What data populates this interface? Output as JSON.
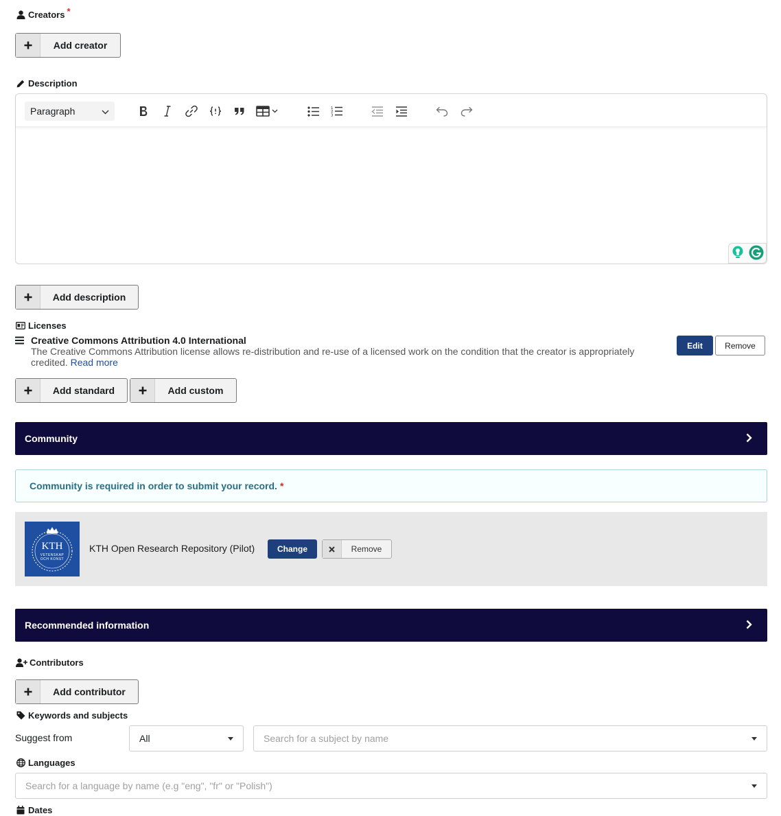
{
  "creators": {
    "label": "Creators",
    "required_mark": "*",
    "add_button": "Add creator"
  },
  "description": {
    "label": "Description",
    "toolbar": {
      "paragraph_select": "Paragraph",
      "icons": [
        "bold-icon",
        "italic-icon",
        "link-icon",
        "code-block-icon",
        "blockquote-icon",
        "table-icon",
        "bulleted-list-icon",
        "numbered-list-icon",
        "outdent-icon",
        "indent-icon",
        "undo-icon",
        "redo-icon"
      ]
    },
    "add_button": "Add description"
  },
  "licenses": {
    "label": "Licenses",
    "items": [
      {
        "title": "Creative Commons Attribution 4.0 International",
        "description_line1": "The Creative Commons Attribution license allows re-distribution and re-use of a licensed work on the condition that the creator is appropriately",
        "description_line2": "credited.",
        "read_more": "Read more",
        "edit": "Edit",
        "remove": "Remove"
      }
    ],
    "add_standard": "Add standard",
    "add_custom": "Add custom"
  },
  "community": {
    "header": "Community",
    "required_message": "Community is required in order to submit your record.",
    "required_mark": "*",
    "selected": {
      "logo_text": "KTH",
      "logo_subtext1": "VETENSKAP",
      "logo_subtext2": "OCH KONST",
      "name": "KTH Open Research Repository (Pilot)",
      "change": "Change",
      "remove": "Remove"
    }
  },
  "recommended": {
    "header": "Recommended information"
  },
  "contributors": {
    "label": "Contributors",
    "add_button": "Add contributor"
  },
  "keywords": {
    "label": "Keywords and subjects",
    "suggest_from_label": "Suggest from",
    "suggest_from_value": "All",
    "search_placeholder": "Search for a subject by name"
  },
  "languages": {
    "label": "Languages",
    "search_placeholder": "Search for a language by name (e.g \"eng\", \"fr\" or \"Polish\")"
  },
  "dates": {
    "label": "Dates"
  },
  "colors": {
    "accordion": "#0f0c3d",
    "primary_button": "#1d3f7c",
    "required": "#db2828",
    "info_text": "#276f86",
    "logo_blue": "#1f4fa0"
  }
}
